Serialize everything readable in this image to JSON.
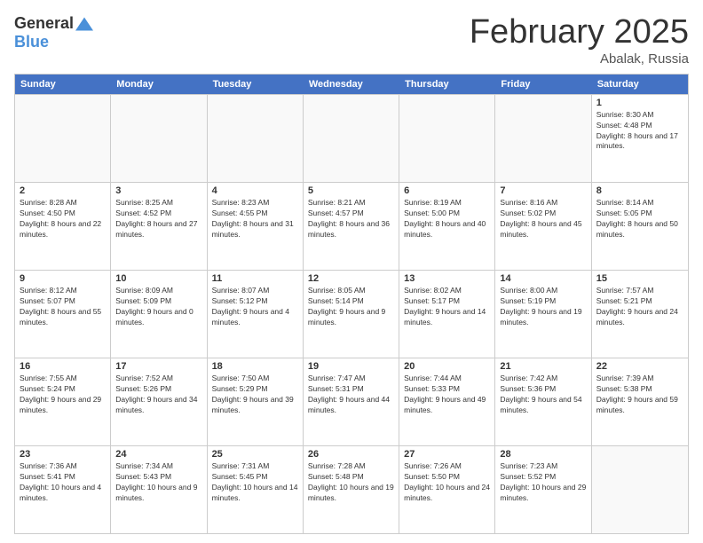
{
  "logo": {
    "general": "General",
    "blue": "Blue"
  },
  "title": "February 2025",
  "subtitle": "Abalak, Russia",
  "days": [
    "Sunday",
    "Monday",
    "Tuesday",
    "Wednesday",
    "Thursday",
    "Friday",
    "Saturday"
  ],
  "rows": [
    [
      {
        "day": "",
        "info": ""
      },
      {
        "day": "",
        "info": ""
      },
      {
        "day": "",
        "info": ""
      },
      {
        "day": "",
        "info": ""
      },
      {
        "day": "",
        "info": ""
      },
      {
        "day": "",
        "info": ""
      },
      {
        "day": "1",
        "info": "Sunrise: 8:30 AM\nSunset: 4:48 PM\nDaylight: 8 hours and 17 minutes."
      }
    ],
    [
      {
        "day": "2",
        "info": "Sunrise: 8:28 AM\nSunset: 4:50 PM\nDaylight: 8 hours and 22 minutes."
      },
      {
        "day": "3",
        "info": "Sunrise: 8:25 AM\nSunset: 4:52 PM\nDaylight: 8 hours and 27 minutes."
      },
      {
        "day": "4",
        "info": "Sunrise: 8:23 AM\nSunset: 4:55 PM\nDaylight: 8 hours and 31 minutes."
      },
      {
        "day": "5",
        "info": "Sunrise: 8:21 AM\nSunset: 4:57 PM\nDaylight: 8 hours and 36 minutes."
      },
      {
        "day": "6",
        "info": "Sunrise: 8:19 AM\nSunset: 5:00 PM\nDaylight: 8 hours and 40 minutes."
      },
      {
        "day": "7",
        "info": "Sunrise: 8:16 AM\nSunset: 5:02 PM\nDaylight: 8 hours and 45 minutes."
      },
      {
        "day": "8",
        "info": "Sunrise: 8:14 AM\nSunset: 5:05 PM\nDaylight: 8 hours and 50 minutes."
      }
    ],
    [
      {
        "day": "9",
        "info": "Sunrise: 8:12 AM\nSunset: 5:07 PM\nDaylight: 8 hours and 55 minutes."
      },
      {
        "day": "10",
        "info": "Sunrise: 8:09 AM\nSunset: 5:09 PM\nDaylight: 9 hours and 0 minutes."
      },
      {
        "day": "11",
        "info": "Sunrise: 8:07 AM\nSunset: 5:12 PM\nDaylight: 9 hours and 4 minutes."
      },
      {
        "day": "12",
        "info": "Sunrise: 8:05 AM\nSunset: 5:14 PM\nDaylight: 9 hours and 9 minutes."
      },
      {
        "day": "13",
        "info": "Sunrise: 8:02 AM\nSunset: 5:17 PM\nDaylight: 9 hours and 14 minutes."
      },
      {
        "day": "14",
        "info": "Sunrise: 8:00 AM\nSunset: 5:19 PM\nDaylight: 9 hours and 19 minutes."
      },
      {
        "day": "15",
        "info": "Sunrise: 7:57 AM\nSunset: 5:21 PM\nDaylight: 9 hours and 24 minutes."
      }
    ],
    [
      {
        "day": "16",
        "info": "Sunrise: 7:55 AM\nSunset: 5:24 PM\nDaylight: 9 hours and 29 minutes."
      },
      {
        "day": "17",
        "info": "Sunrise: 7:52 AM\nSunset: 5:26 PM\nDaylight: 9 hours and 34 minutes."
      },
      {
        "day": "18",
        "info": "Sunrise: 7:50 AM\nSunset: 5:29 PM\nDaylight: 9 hours and 39 minutes."
      },
      {
        "day": "19",
        "info": "Sunrise: 7:47 AM\nSunset: 5:31 PM\nDaylight: 9 hours and 44 minutes."
      },
      {
        "day": "20",
        "info": "Sunrise: 7:44 AM\nSunset: 5:33 PM\nDaylight: 9 hours and 49 minutes."
      },
      {
        "day": "21",
        "info": "Sunrise: 7:42 AM\nSunset: 5:36 PM\nDaylight: 9 hours and 54 minutes."
      },
      {
        "day": "22",
        "info": "Sunrise: 7:39 AM\nSunset: 5:38 PM\nDaylight: 9 hours and 59 minutes."
      }
    ],
    [
      {
        "day": "23",
        "info": "Sunrise: 7:36 AM\nSunset: 5:41 PM\nDaylight: 10 hours and 4 minutes."
      },
      {
        "day": "24",
        "info": "Sunrise: 7:34 AM\nSunset: 5:43 PM\nDaylight: 10 hours and 9 minutes."
      },
      {
        "day": "25",
        "info": "Sunrise: 7:31 AM\nSunset: 5:45 PM\nDaylight: 10 hours and 14 minutes."
      },
      {
        "day": "26",
        "info": "Sunrise: 7:28 AM\nSunset: 5:48 PM\nDaylight: 10 hours and 19 minutes."
      },
      {
        "day": "27",
        "info": "Sunrise: 7:26 AM\nSunset: 5:50 PM\nDaylight: 10 hours and 24 minutes."
      },
      {
        "day": "28",
        "info": "Sunrise: 7:23 AM\nSunset: 5:52 PM\nDaylight: 10 hours and 29 minutes."
      },
      {
        "day": "",
        "info": ""
      }
    ]
  ]
}
